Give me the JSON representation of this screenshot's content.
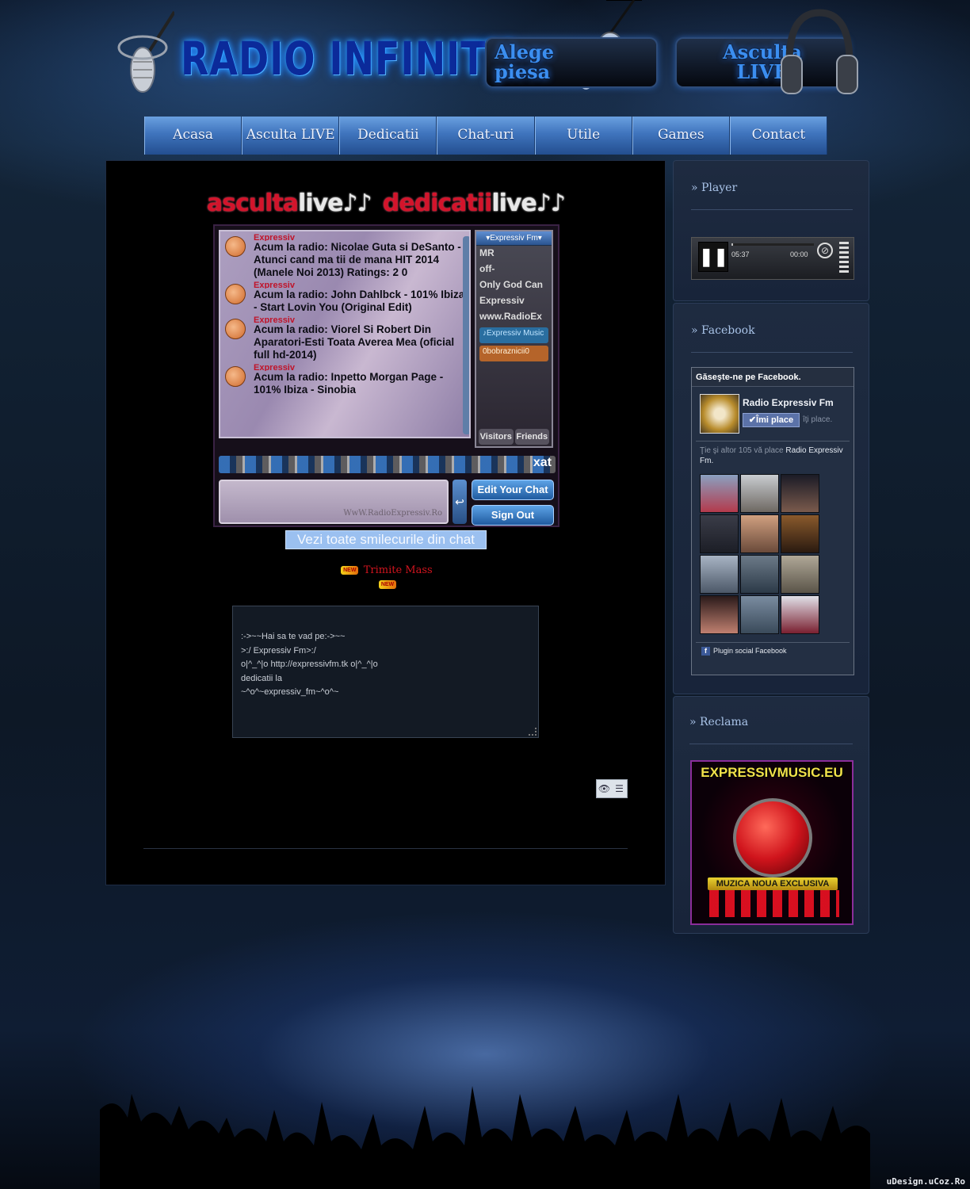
{
  "header": {
    "logo_text": "RADIO INFINITY",
    "btn_alege_line1": "Alege",
    "btn_alege_line2": "piesa",
    "btn_asculta_line1": "Asculta",
    "btn_asculta_line2": "LIVE"
  },
  "nav": [
    "Acasa",
    "Asculta LIVE",
    "Dedicatii LIVE",
    "Chat-uri",
    "Utile",
    "Games",
    "Contact"
  ],
  "main": {
    "banner_red1": "asculta",
    "banner_white1": "live♪♪",
    "banner_red2": "dedicatii",
    "banner_white2": "live♪♪",
    "chat": {
      "messages": [
        {
          "who": "Expressiv",
          "text": "Acum la radio: Nicolae Guta si DeSanto - Atunci cand ma tii de mana HIT 2014  (Manele Noi 2013)  Ratings: 2  0"
        },
        {
          "who": "Expressiv",
          "text": "Acum la radio: John Dahlbck - 101% Ibiza - Start Lovin You  (Original Edit)"
        },
        {
          "who": "Expressiv",
          "text": "Acum la radio: Viorel Si Robert Din Aparatori-Esti Toata Averea Mea (oficial full hd-2014)"
        },
        {
          "who": "Expressiv",
          "text": "Acum la radio: Inpetto Morgan Page - 101% Ibiza - Sinobia"
        }
      ],
      "users_header": "▾Expressiv Fm▾",
      "users": [
        "MR",
        "off-",
        "Only God Can",
        "Expressiv",
        "www.RadioEx"
      ],
      "tag_blue": "♪Expressiv Music",
      "tag_orange": "0bobraznicii0",
      "tab_visitors": "Visitors",
      "tab_friends": "Friends",
      "xat_label": "xat",
      "input_watermark": "WwW.RadioExpressiv.Ro",
      "edit_btn": "Edit Your Chat",
      "signout_btn": "Sign Out",
      "send_icon": "↩"
    },
    "smile_link": "Vezi toate smilecurile din chat",
    "new_badge": "NEW",
    "mass_link": "Trimite Mass",
    "dedic_lines": [
      ":->~~Hai sa te vad pe:->~~",
      ">:/ Expressiv Fm>:/",
      "o|^_^|o http://expressivfm.tk o|^_^|o",
      "dedicatii la",
      "~^o^~expressiv_fm~^o^~"
    ]
  },
  "sidebar": {
    "player_title": "» Player",
    "player": {
      "elapsed": "05:37",
      "remaining": "00:00",
      "progress": 0.02
    },
    "facebook_title": "» Facebook",
    "fb": {
      "header": "Găseşte-ne pe Facebook.",
      "page_name": "Radio Expressiv Fm",
      "like_btn": "✔Îmi place",
      "likes_suffix": "îţi place.",
      "friends_text": "Ţie şi altor 105 vă place",
      "friends_page": "Radio Expressiv Fm.",
      "plugin": "Plugin social Facebook"
    },
    "reclama_title": "» Reclama",
    "ad": {
      "title": "EXPRESSIVMUSIC.EU",
      "tagline": "MUZICA NOUA EXCLUSIVA"
    }
  },
  "footer": {
    "credit": "uDesign.uCoz.Ro"
  },
  "colors": {
    "accent_blue": "#3b8ef0",
    "banner_red": "#d3142b",
    "nav_blue": "#3f74bd"
  }
}
